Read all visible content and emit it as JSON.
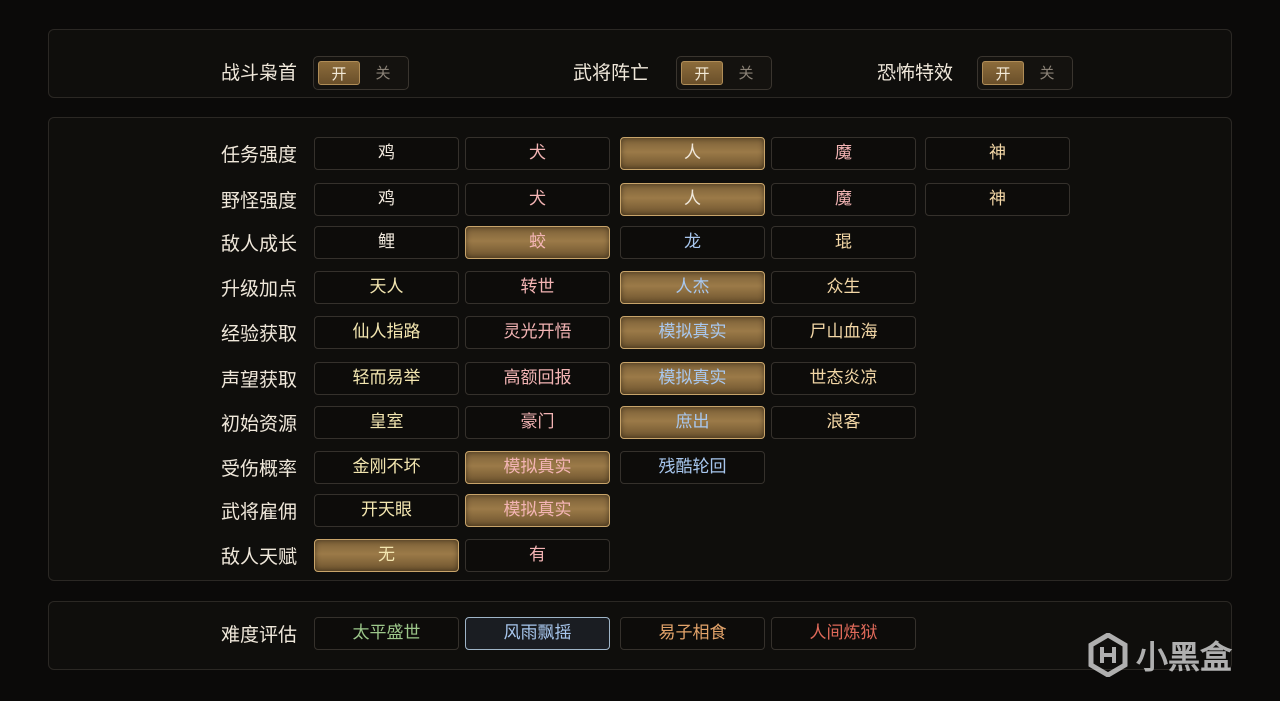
{
  "toggles": [
    {
      "label": "战斗枭首",
      "on": "开",
      "off": "关"
    },
    {
      "label": "武将阵亡",
      "on": "开",
      "off": "关"
    },
    {
      "label": "恐怖特效",
      "on": "开",
      "off": "关"
    }
  ],
  "settings": [
    {
      "label": "任务强度",
      "options": [
        "鸡",
        "犬",
        "人",
        "魔",
        "神"
      ],
      "selected": 2,
      "colors": [
        "#f0e8dc",
        "#f3b4b4",
        "#f0e8dc",
        "#f3b4b4",
        "#f3d7a6"
      ]
    },
    {
      "label": "野怪强度",
      "options": [
        "鸡",
        "犬",
        "人",
        "魔",
        "神"
      ],
      "selected": 2,
      "colors": [
        "#f0e8dc",
        "#f3b4b4",
        "#f0e8dc",
        "#f3b4b4",
        "#f3d7a6"
      ]
    },
    {
      "label": "敌人成长",
      "options": [
        "鲤",
        "蛟",
        "龙",
        "琨"
      ],
      "selected": 1,
      "colors": [
        "#f0e8dc",
        "#f3b4b4",
        "#a8c7ee",
        "#f3d7a6"
      ]
    },
    {
      "label": "升级加点",
      "options": [
        "天人",
        "转世",
        "人杰",
        "众生"
      ],
      "selected": 2,
      "colors": [
        "#f3e6b0",
        "#f3b4b4",
        "#a8c7ee",
        "#f3d7a6"
      ]
    },
    {
      "label": "经验获取",
      "options": [
        "仙人指路",
        "灵光开悟",
        "模拟真实",
        "尸山血海"
      ],
      "selected": 2,
      "colors": [
        "#f3e6b0",
        "#f3b4b4",
        "#a8c7ee",
        "#f3d7a6"
      ]
    },
    {
      "label": "声望获取",
      "options": [
        "轻而易举",
        "高额回报",
        "模拟真实",
        "世态炎凉"
      ],
      "selected": 2,
      "colors": [
        "#f3e6b0",
        "#f3b4b4",
        "#a8c7ee",
        "#f3d7a6"
      ]
    },
    {
      "label": "初始资源",
      "options": [
        "皇室",
        "豪门",
        "庶出",
        "浪客"
      ],
      "selected": 2,
      "colors": [
        "#f3e6b0",
        "#f3b4b4",
        "#a8c7ee",
        "#f3d7a6"
      ]
    },
    {
      "label": "受伤概率",
      "options": [
        "金刚不坏",
        "模拟真实",
        "残酷轮回"
      ],
      "selected": 1,
      "colors": [
        "#f3e6b0",
        "#f3b4b4",
        "#a8c7ee"
      ]
    },
    {
      "label": "武将雇佣",
      "options": [
        "开天眼",
        "模拟真实"
      ],
      "selected": 1,
      "colors": [
        "#f3e6b0",
        "#f3b4b4"
      ]
    },
    {
      "label": "敌人天赋",
      "options": [
        "无",
        "有"
      ],
      "selected": 0,
      "colors": [
        "#f3e6b0",
        "#f3b4b4"
      ]
    }
  ],
  "difficulty": {
    "label": "难度评估",
    "options": [
      "太平盛世",
      "风雨飘摇",
      "易子相食",
      "人间炼狱"
    ],
    "selected": 1,
    "colors": [
      "#9cc78a",
      "#a8c7ee",
      "#e2a36a",
      "#e06a5a"
    ]
  },
  "watermark": {
    "text": "小黑盒",
    "icon": "heybox-logo-icon"
  }
}
